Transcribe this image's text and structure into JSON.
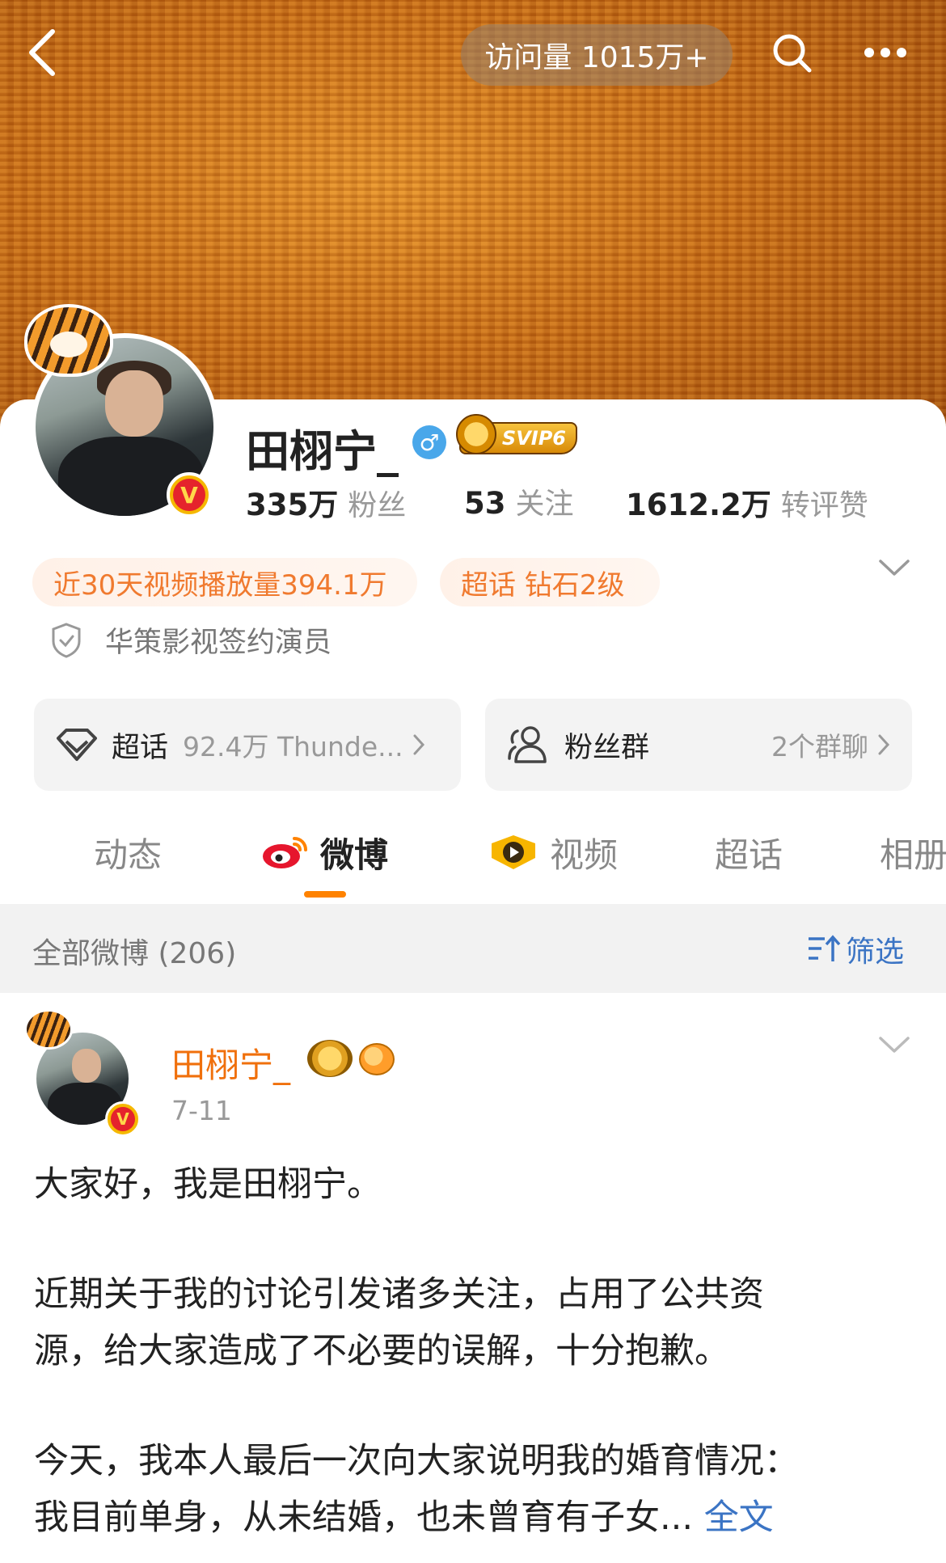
{
  "header": {
    "visits": "访问量 1015万+",
    "icons": [
      "back-arrow-icon",
      "search-icon",
      "more-icon"
    ]
  },
  "profile": {
    "name": "田栩宁_",
    "gender": "♂",
    "vip": "SVIP6",
    "followers_num": "335万",
    "followers_label": "粉丝",
    "following_num": "53",
    "following_label": "关注",
    "reposts_num": "1612.2万",
    "reposts_label": "转评赞",
    "stat_pill": "近30天视频播放量394.1万",
    "supertopic_pill": "超话 钻石2级",
    "signature": "华策影视签约演员"
  },
  "boxes": {
    "supertopic_label": "超话",
    "supertopic_sub": "92.4万 Thunde...",
    "fangroup_label": "粉丝群",
    "fangroup_sub": "2个群聊"
  },
  "tabs": [
    "动态",
    "微博",
    "视频",
    "超话",
    "相册"
  ],
  "filter": {
    "all": "全部微博 (206)",
    "filter_label": "筛选"
  },
  "post": {
    "author": "田栩宁_",
    "date": "7-11",
    "para1": "大家好，我是田栩宁。",
    "para2_line1": "近期关于我的讨论引发诸多关注，占用了公共资",
    "para2_line2": "源，给大家造成了不必要的误解，十分抱歉。",
    "para3_line1": "今天，我本人最后一次向大家说明我的婚育情况：",
    "para3_line2": "我目前单身，从未结婚，也未曾育有子女...",
    "more": "全文"
  },
  "colors": {
    "accent_orange": "#ff8200",
    "link_blue": "#3b74c4",
    "name_orange": "#f0700c"
  }
}
